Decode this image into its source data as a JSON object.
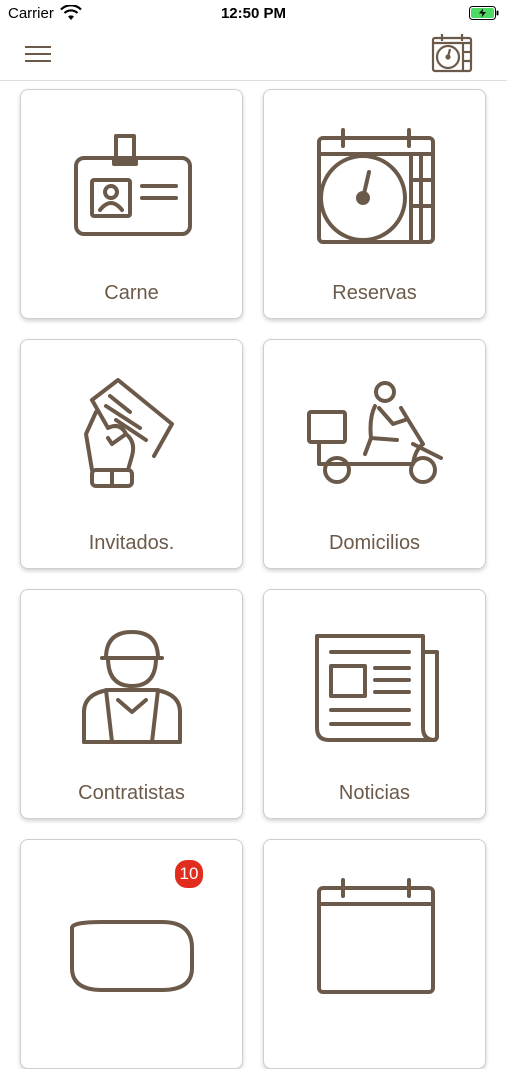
{
  "status_bar": {
    "carrier": "Carrier",
    "time": "12:50 PM"
  },
  "header": {
    "menu_icon": "hamburger-menu-icon",
    "calendar_icon": "calendar-clock-icon"
  },
  "tiles": [
    {
      "label": "Carne",
      "icon": "id-card-icon"
    },
    {
      "label": "Reservas",
      "icon": "calendar-clock-icon"
    },
    {
      "label": "Invitados.",
      "icon": "hand-ticket-icon"
    },
    {
      "label": "Domicilios",
      "icon": "delivery-scooter-icon"
    },
    {
      "label": "Contratistas",
      "icon": "worker-icon"
    },
    {
      "label": "Noticias",
      "icon": "newspaper-icon"
    },
    {
      "label": "",
      "icon": "chat-bubbles-icon",
      "badge": "10"
    },
    {
      "label": "",
      "icon": "calendar-icon"
    }
  ],
  "colors": {
    "icon": "#6b5a4a",
    "badge": "#e02d1d"
  }
}
